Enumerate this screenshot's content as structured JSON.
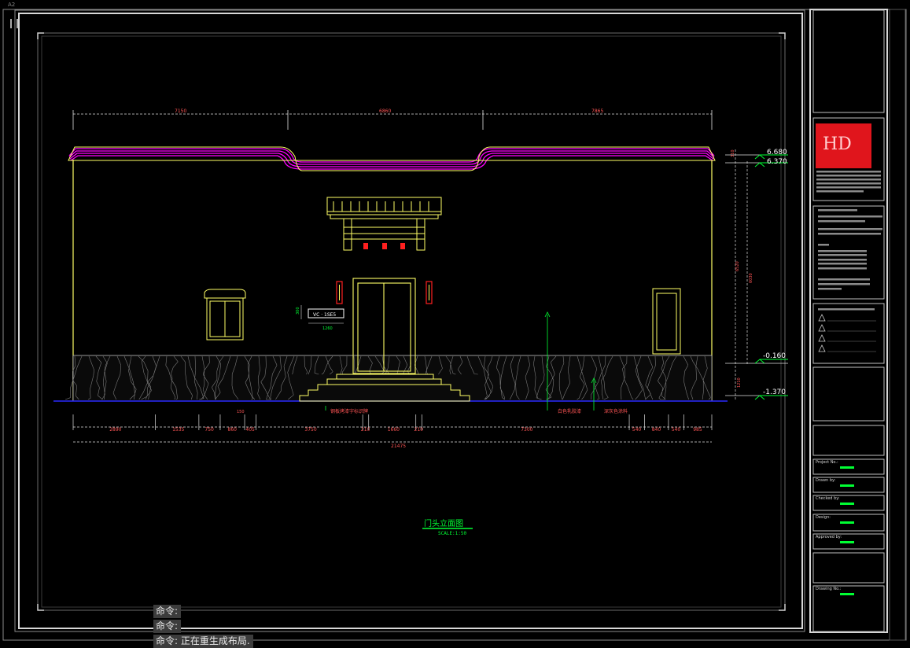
{
  "ucs_label": "A2",
  "colors": {
    "background": "#000000",
    "frame": "#bfbfbf",
    "wall": "#ffff66",
    "roof": "#ff00ff",
    "dimension": "#00ff33",
    "ground": "#1a1aff",
    "lantern": "#ff2020",
    "logo": "#e0151c"
  },
  "drawing": {
    "top_dims": [
      "7150",
      "6860",
      "7865"
    ],
    "bottom_dims": [
      "2890",
      "1535",
      "750",
      "860",
      "405",
      "3750",
      "210",
      "1660",
      "210",
      "7300",
      "540",
      "840",
      "540",
      "985"
    ],
    "overall_width": "21475",
    "small_dims": [
      "150",
      "1260"
    ],
    "right_dims": [
      "310",
      "6520",
      "6030",
      "1210"
    ],
    "elevation_marks": [
      "6.680",
      "6.370",
      "-0.160",
      "-1.370"
    ],
    "sign_text": "VC · 1SE5",
    "sign_dim": "300",
    "notes": [
      "钢板烤漆字标识牌",
      "白色乳胶漆",
      "深灰色涂料"
    ],
    "title": "门头立面图",
    "scale": "SCALE:1:50"
  },
  "title_block": {
    "logo_text": "HD",
    "fields": [
      {
        "label": "Project No.:",
        "value": ""
      },
      {
        "label": "Drawn by:",
        "value": ""
      },
      {
        "label": "Checked by:",
        "value": ""
      },
      {
        "label": "Design:",
        "value": ""
      },
      {
        "label": "Approved by:",
        "value": ""
      },
      {
        "label": "Drawing No.:",
        "value": ""
      }
    ]
  },
  "command_lines": [
    "命令:",
    "命令:",
    "命令: 正在重生成布局."
  ]
}
